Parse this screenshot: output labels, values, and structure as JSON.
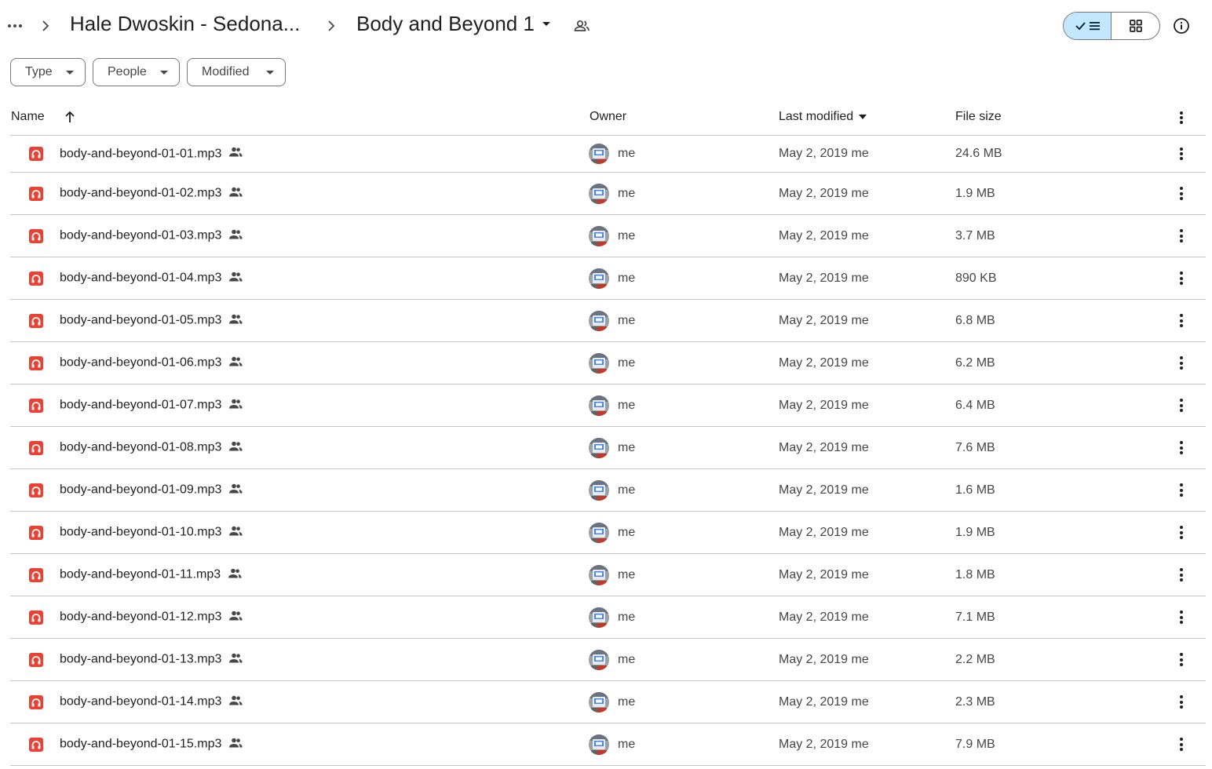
{
  "breadcrumb": {
    "parent": "Hale Dwoskin - Sedona...",
    "current": "Body and Beyond 1"
  },
  "filters": {
    "type": "Type",
    "people": "People",
    "modified": "Modified"
  },
  "columns": {
    "name": "Name",
    "owner": "Owner",
    "last_modified": "Last modified",
    "file_size": "File size"
  },
  "colors": {
    "accent_selected": "#c2e7ff",
    "audio_icon": "#e94235",
    "divider": "#c7c7c7"
  },
  "files": [
    {
      "name": "body-and-beyond-01-01.mp3",
      "owner": "me",
      "modified": "May 2, 2019 me",
      "size": "24.6 MB"
    },
    {
      "name": "body-and-beyond-01-02.mp3",
      "owner": "me",
      "modified": "May 2, 2019 me",
      "size": "1.9 MB"
    },
    {
      "name": "body-and-beyond-01-03.mp3",
      "owner": "me",
      "modified": "May 2, 2019 me",
      "size": "3.7 MB"
    },
    {
      "name": "body-and-beyond-01-04.mp3",
      "owner": "me",
      "modified": "May 2, 2019 me",
      "size": "890 KB"
    },
    {
      "name": "body-and-beyond-01-05.mp3",
      "owner": "me",
      "modified": "May 2, 2019 me",
      "size": "6.8 MB"
    },
    {
      "name": "body-and-beyond-01-06.mp3",
      "owner": "me",
      "modified": "May 2, 2019 me",
      "size": "6.2 MB"
    },
    {
      "name": "body-and-beyond-01-07.mp3",
      "owner": "me",
      "modified": "May 2, 2019 me",
      "size": "6.4 MB"
    },
    {
      "name": "body-and-beyond-01-08.mp3",
      "owner": "me",
      "modified": "May 2, 2019 me",
      "size": "7.6 MB"
    },
    {
      "name": "body-and-beyond-01-09.mp3",
      "owner": "me",
      "modified": "May 2, 2019 me",
      "size": "1.6 MB"
    },
    {
      "name": "body-and-beyond-01-10.mp3",
      "owner": "me",
      "modified": "May 2, 2019 me",
      "size": "1.9 MB"
    },
    {
      "name": "body-and-beyond-01-11.mp3",
      "owner": "me",
      "modified": "May 2, 2019 me",
      "size": "1.8 MB"
    },
    {
      "name": "body-and-beyond-01-12.mp3",
      "owner": "me",
      "modified": "May 2, 2019 me",
      "size": "7.1 MB"
    },
    {
      "name": "body-and-beyond-01-13.mp3",
      "owner": "me",
      "modified": "May 2, 2019 me",
      "size": "2.2 MB"
    },
    {
      "name": "body-and-beyond-01-14.mp3",
      "owner": "me",
      "modified": "May 2, 2019 me",
      "size": "2.3 MB"
    },
    {
      "name": "body-and-beyond-01-15.mp3",
      "owner": "me",
      "modified": "May 2, 2019 me",
      "size": "7.9 MB"
    }
  ]
}
